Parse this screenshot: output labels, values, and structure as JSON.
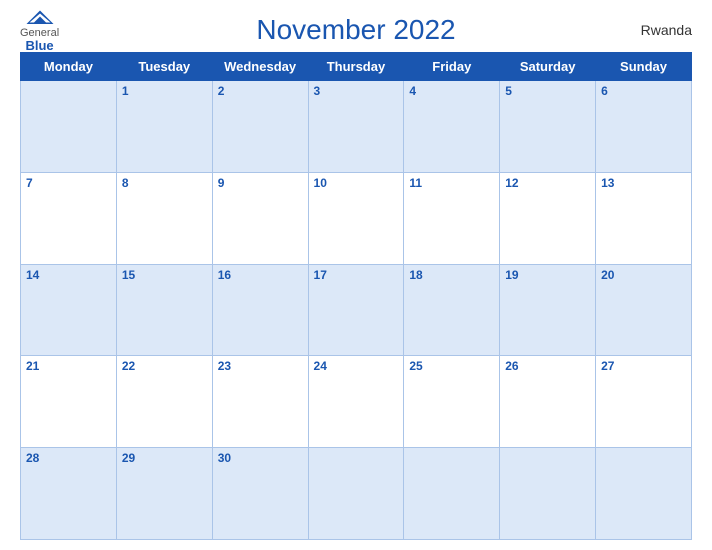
{
  "header": {
    "logo_general": "General",
    "logo_blue": "Blue",
    "title": "November 2022",
    "country": "Rwanda"
  },
  "days_of_week": [
    "Monday",
    "Tuesday",
    "Wednesday",
    "Thursday",
    "Friday",
    "Saturday",
    "Sunday"
  ],
  "weeks": [
    [
      "",
      "1",
      "2",
      "3",
      "4",
      "5",
      "6"
    ],
    [
      "7",
      "8",
      "9",
      "10",
      "11",
      "12",
      "13"
    ],
    [
      "14",
      "15",
      "16",
      "17",
      "18",
      "19",
      "20"
    ],
    [
      "21",
      "22",
      "23",
      "24",
      "25",
      "26",
      "27"
    ],
    [
      "28",
      "29",
      "30",
      "",
      "",
      "",
      ""
    ]
  ]
}
